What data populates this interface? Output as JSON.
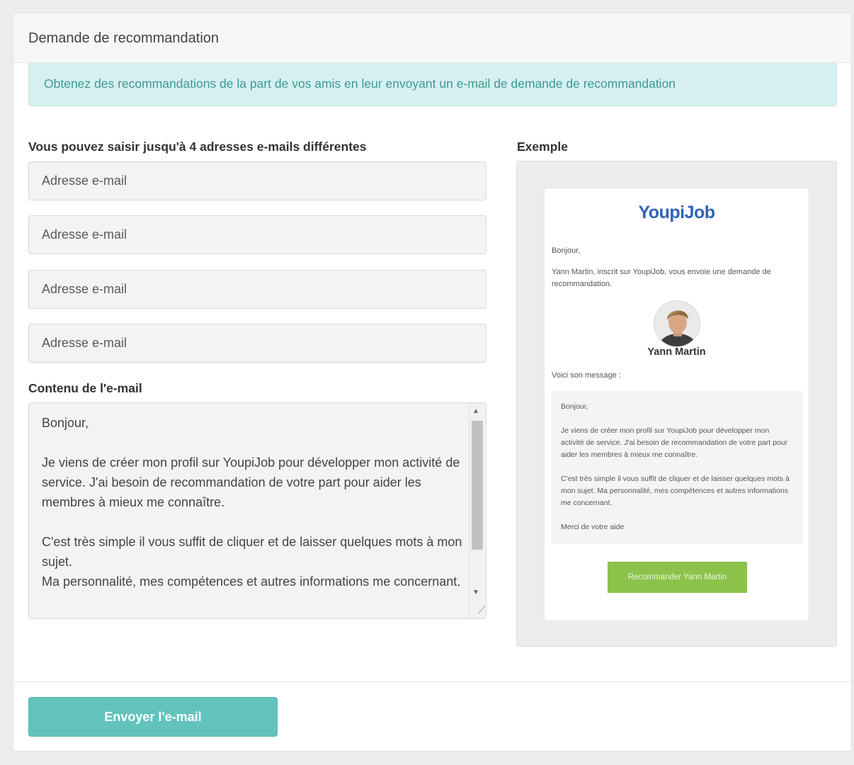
{
  "panel": {
    "title": "Demande de recommandation",
    "info": "Obtenez des recommandations de la part de vos amis en leur envoyant un e-mail de demande de recommandation"
  },
  "form": {
    "emails_label": "Vous pouvez saisir jusqu'à 4 adresses e-mails différentes",
    "email_inputs": [
      {
        "placeholder": "Adresse e-mail",
        "value": ""
      },
      {
        "placeholder": "Adresse e-mail",
        "value": ""
      },
      {
        "placeholder": "Adresse e-mail",
        "value": ""
      },
      {
        "placeholder": "Adresse e-mail",
        "value": ""
      }
    ],
    "content_label": "Contenu de l'e-mail",
    "content_lines": [
      "Bonjour,",
      "",
      "Je viens de créer mon profil sur YoupiJob pour développer mon activité de service. J'ai besoin de recommandation de votre part pour aider les membres à mieux me connaître.",
      "",
      "C'est très simple il vous suffit de cliquer et de laisser quelques mots à mon sujet.",
      "Ma personnalité, mes compétences et autres informations me concernant."
    ]
  },
  "example": {
    "label": "Exemple",
    "logo": "YoupiJob",
    "greeting": "Bonjour,",
    "intro": "Yann Martin, inscrit sur YoupiJob, vous envoie une demande de recommandation.",
    "sender_name": "Yann Martin",
    "message_intro": "Voici son message :",
    "message": {
      "p1": "Bonjour,",
      "p2": "Je viens de créer mon profil sur YoupiJob pour développer mon activité de service. J'ai besoin de recommandation de votre part pour aider les membres à mieux me connaître.",
      "p3": "C'est très simple il vous suffit de cliquer et de laisser quelques mots à mon sujet. Ma personnalité, mes compétences et autres informations me concernant.",
      "p4": "Merci de votre aide"
    },
    "button_label": "Recommander Yann Martin"
  },
  "footer": {
    "send_label": "Envoyer l'e-mail"
  },
  "colors": {
    "accent": "#62c3bc",
    "info_bg": "#d8efef",
    "info_text": "#3a9a96",
    "preview_button": "#8bc34a",
    "logo": "#2f63b6"
  }
}
